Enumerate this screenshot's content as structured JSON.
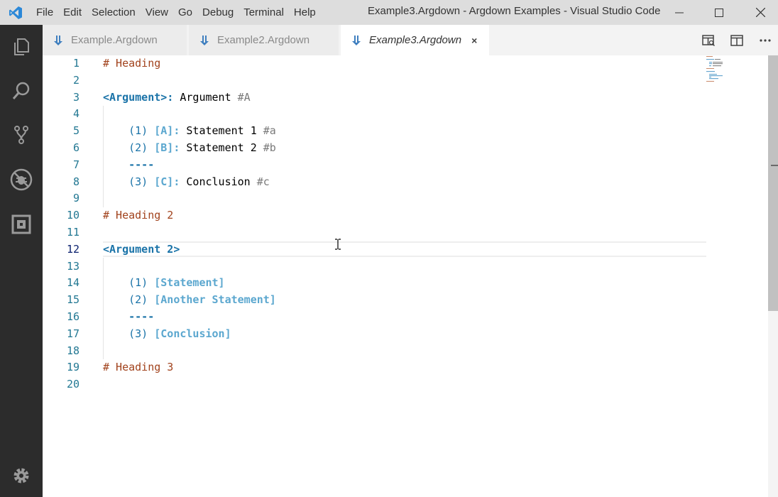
{
  "titlebar": {
    "menu": [
      "File",
      "Edit",
      "Selection",
      "View",
      "Go",
      "Debug",
      "Terminal",
      "Help"
    ],
    "window_title": "Example3.Argdown - Argdown Examples - Visual Studio Code"
  },
  "tabs": [
    {
      "label": "Example.Argdown",
      "active": false
    },
    {
      "label": "Example2.Argdown",
      "active": false
    },
    {
      "label": "Example3.Argdown",
      "active": true,
      "close": "×"
    }
  ],
  "editor": {
    "line_numbers": [
      "1",
      "2",
      "3",
      "4",
      "5",
      "6",
      "7",
      "8",
      "9",
      "10",
      "11",
      "12",
      "13",
      "14",
      "15",
      "16",
      "17",
      "18",
      "19",
      "20"
    ],
    "lines": {
      "l1": {
        "heading": "# Heading"
      },
      "l3": {
        "arg": "<Argument>",
        "colon": ":",
        "text": " Argument ",
        "tag": "#A"
      },
      "l5": {
        "num": "(1) ",
        "stmt": "[A]:",
        "text": " Statement 1 ",
        "tag": "#a"
      },
      "l6": {
        "num": "(2) ",
        "stmt": "[B]:",
        "text": " Statement 2 ",
        "tag": "#b"
      },
      "l7": {
        "sep": "----"
      },
      "l8": {
        "num": "(3) ",
        "stmt": "[C]:",
        "text": " Conclusion ",
        "tag": "#c"
      },
      "l10": {
        "heading": "# Heading 2"
      },
      "l12": {
        "arg": "<Argument 2>"
      },
      "l14": {
        "num": "(1) ",
        "stmt": "[Statement]"
      },
      "l15": {
        "num": "(2) ",
        "stmt": "[Another Statement]"
      },
      "l16": {
        "sep": "----"
      },
      "l17": {
        "num": "(3) ",
        "stmt": "[Conclusion]"
      },
      "l19": {
        "heading": "# Heading 3"
      }
    }
  },
  "colors": {
    "titlebar_bg": "#dddddd",
    "activitybar_bg": "#2c2c2c",
    "heading": "#a1421c",
    "keyword": "#1a73a8",
    "statement": "#5ba7cf",
    "line_number": "#237893"
  },
  "icons": {
    "app": "vscode-logo-icon",
    "activity": [
      "explorer-icon",
      "search-icon",
      "source-control-icon",
      "debug-icon",
      "extensions-icon",
      "gear-icon"
    ],
    "tab_actions": [
      "open-preview-icon",
      "split-editor-icon",
      "more-actions-icon"
    ]
  }
}
